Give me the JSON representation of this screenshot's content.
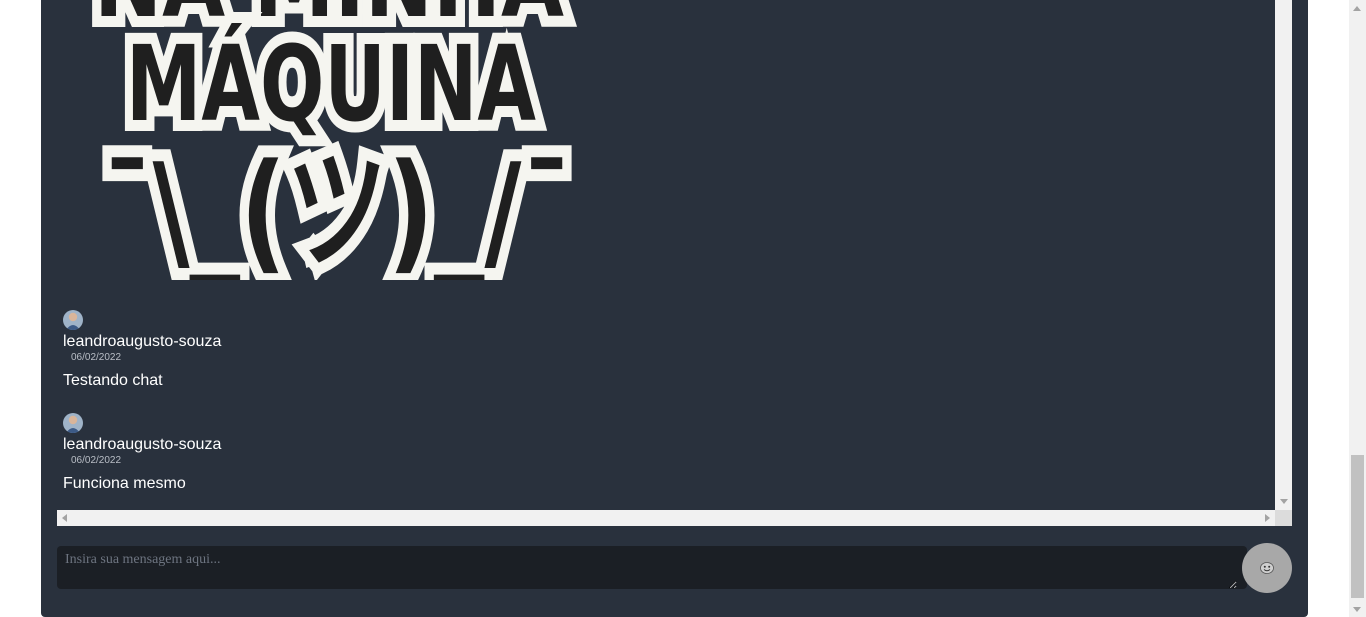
{
  "sticker": {
    "line1": "NA MINHA",
    "line2": "MÁQUINA",
    "shrug": "¯\\_(ツ)_/¯"
  },
  "messages": [
    {
      "author": "leandroaugusto-souza",
      "date": "06/02/2022",
      "text": "Testando chat"
    },
    {
      "author": "leandroaugusto-souza",
      "date": "06/02/2022",
      "text": "Funciona mesmo"
    }
  ],
  "composer": {
    "placeholder": "Insira sua mensagem aqui...",
    "value": ""
  },
  "send_button": {
    "icon": "emoji-icon"
  },
  "colors": {
    "panel": "#29313d",
    "input": "#1b1f25",
    "send": "#a8a8a8"
  }
}
